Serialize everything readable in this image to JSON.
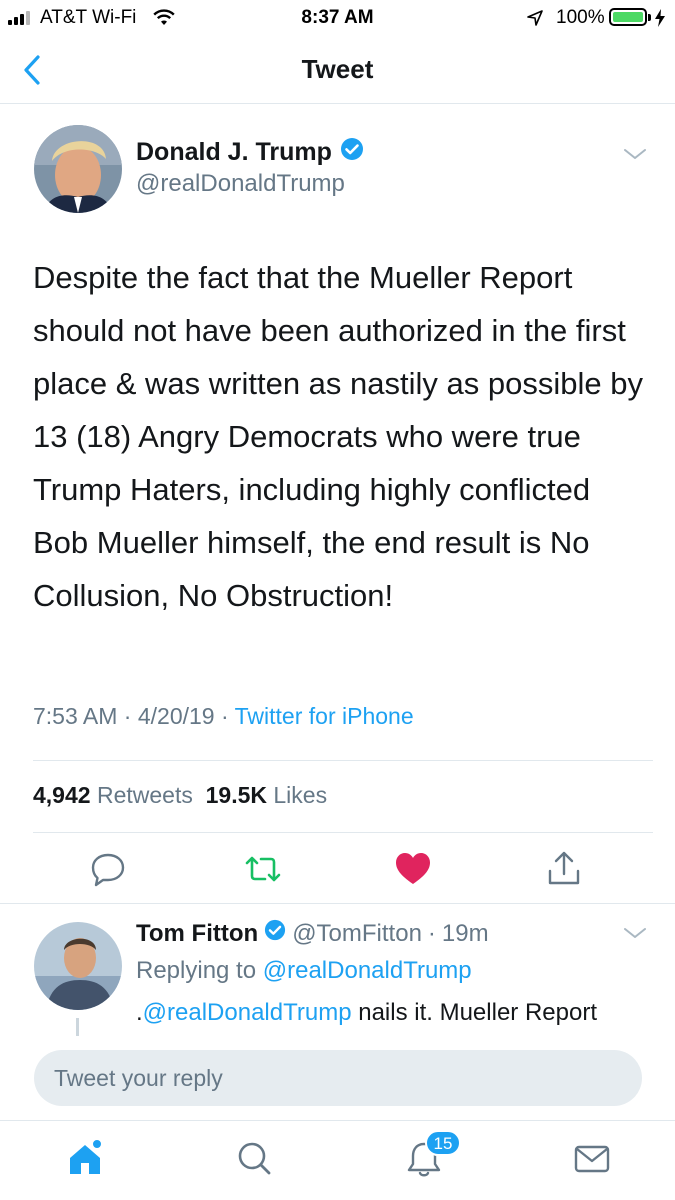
{
  "status_bar": {
    "carrier": "AT&T Wi-Fi",
    "time": "8:37 AM",
    "battery": "100%",
    "battery_level": 1.0,
    "signal_bars": 3
  },
  "nav": {
    "title": "Tweet"
  },
  "tweet": {
    "author_name": "Donald J. Trump",
    "author_handle": "@realDonaldTrump",
    "text": "Despite the fact that the Mueller Report should not have been authorized in the first place & was written as nastily as possible by 13 (18) Angry Democrats who were true Trump Haters, including highly conflicted Bob Mueller himself, the end result is No Collusion, No Obstruction!",
    "time": "7:53 AM",
    "date": "4/20/19",
    "sep": "·",
    "source": "Twitter for iPhone",
    "retweets": "4,942",
    "retweets_label": "Retweets",
    "likes": "19.5K",
    "likes_label": "Likes",
    "liked": true
  },
  "reply": {
    "name": "Tom Fitton",
    "handle": "@TomFitton",
    "sep": "·",
    "age": "19m",
    "replying_label": "Replying to",
    "replying_to": "@realDonaldTrump",
    "text_prefix": ".",
    "text_mention": "@realDonaldTrump",
    "text_rest": " nails it. Mueller Report"
  },
  "compose": {
    "placeholder": "Tweet your reply"
  },
  "tabs": {
    "notifications_badge": "15"
  },
  "colors": {
    "accent": "#1da1f2",
    "like": "#e0245e",
    "retweet": "#17bf63",
    "muted": "#657786",
    "text": "#14171a"
  },
  "icons": [
    "back-arrow-icon",
    "wifi-icon",
    "location-arrow-icon",
    "battery-icon",
    "verified-badge-icon",
    "chevron-down-icon",
    "reply-icon",
    "retweet-icon",
    "heart-icon",
    "share-icon",
    "home-icon",
    "search-icon",
    "notifications-bell-icon",
    "messages-envelope-icon"
  ]
}
